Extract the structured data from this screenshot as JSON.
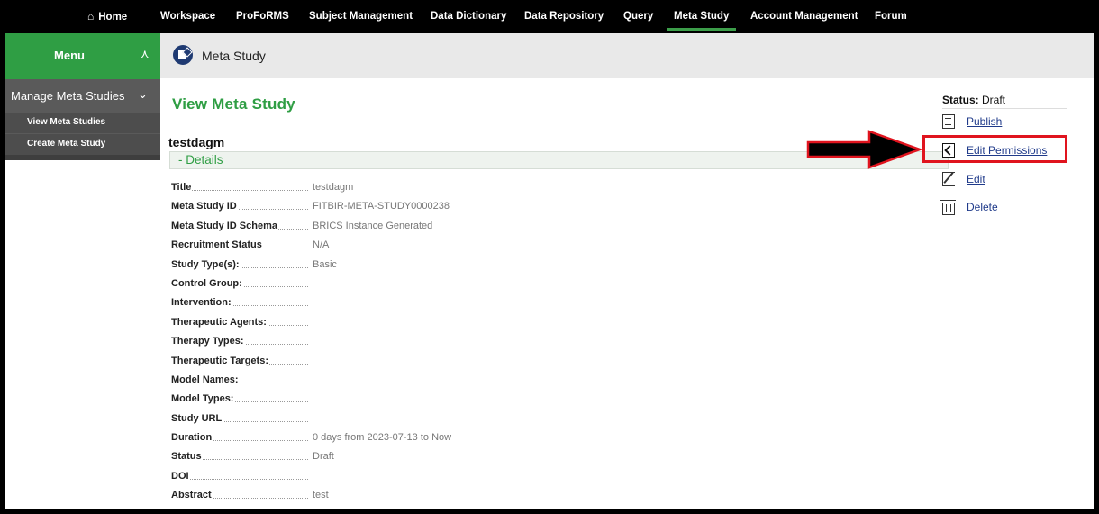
{
  "nav": {
    "items": [
      {
        "label": "Home",
        "active": false
      },
      {
        "label": "Workspace",
        "active": false
      },
      {
        "label": "ProFoRMS",
        "active": false
      },
      {
        "label": "Subject Management",
        "active": false
      },
      {
        "label": "Data Dictionary",
        "active": false
      },
      {
        "label": "Data Repository",
        "active": false
      },
      {
        "label": "Query",
        "active": false
      },
      {
        "label": "Meta Study",
        "active": true
      },
      {
        "label": "Account Management",
        "active": false
      },
      {
        "label": "Forum",
        "active": false
      }
    ]
  },
  "sidebar": {
    "menu_title": "Menu",
    "section_label": "Manage Meta Studies",
    "items": [
      "View Meta Studies",
      "Create Meta Study"
    ]
  },
  "pagebar": {
    "title": "Meta Study"
  },
  "main": {
    "heading": "View Meta Study",
    "study_name": "testdagm",
    "details_label": "- Details",
    "fields": [
      {
        "label": "Title",
        "value": "testdagm"
      },
      {
        "label": "Meta Study ID",
        "value": "FITBIR-META-STUDY0000238"
      },
      {
        "label": "Meta Study ID Schema",
        "value": "BRICS Instance Generated"
      },
      {
        "label": "Recruitment Status",
        "value": "N/A"
      },
      {
        "label": "Study Type(s):",
        "value": "Basic"
      },
      {
        "label": "Control Group:",
        "value": ""
      },
      {
        "label": "Intervention:",
        "value": ""
      },
      {
        "label": "Therapeutic Agents:",
        "value": ""
      },
      {
        "label": "Therapy Types:",
        "value": ""
      },
      {
        "label": "Therapeutic Targets:",
        "value": ""
      },
      {
        "label": "Model Names:",
        "value": ""
      },
      {
        "label": "Model Types:",
        "value": ""
      },
      {
        "label": "Study URL",
        "value": ""
      },
      {
        "label": "Duration",
        "value": "0 days from 2023-07-13 to Now"
      },
      {
        "label": "Status",
        "value": "Draft"
      },
      {
        "label": "DOI",
        "value": ""
      },
      {
        "label": "Abstract",
        "value": "test"
      }
    ]
  },
  "actions": {
    "status_label": "Status:",
    "status_value": "Draft",
    "publish": "Publish",
    "edit_permissions": "Edit Permissions",
    "edit": "Edit",
    "delete": "Delete"
  },
  "colors": {
    "accent_green": "#2f9e44",
    "highlight_red": "#e0141e",
    "link_blue": "#1f3a8a"
  }
}
